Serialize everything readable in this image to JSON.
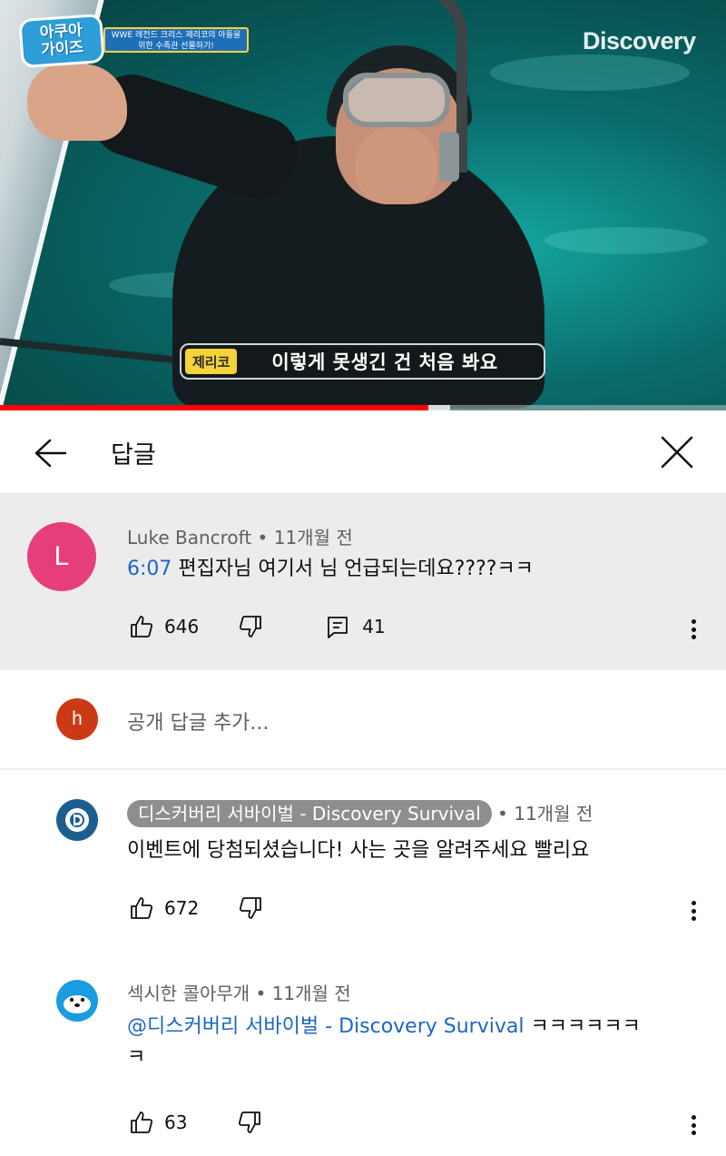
{
  "video": {
    "show_logo_lines": [
      "아쿠아",
      "가이즈"
    ],
    "show_subtitle": "WWE 레전드 크리스 제리코의 아들을 위한 수족관 선물하기!",
    "channel_watermark": "Discovery",
    "caption_speaker": "제리코",
    "caption_text": "이렇게 못생긴 건 처음 봐요",
    "progress_fraction": 0.59,
    "buffer_fraction": 0.62
  },
  "header": {
    "title": "답글",
    "back_icon": "arrow-left-icon",
    "close_icon": "close-icon"
  },
  "parent_comment": {
    "avatar_letter": "L",
    "avatar_color": "#e63e7c",
    "author": "Luke Bancroft",
    "time": "11개월 전",
    "timestamp_link": "6:07",
    "text": " 편집자님 여기서 님 언급되는데요????ㅋㅋ",
    "likes": "646",
    "replies": "41"
  },
  "add_reply": {
    "avatar_letter": "h",
    "avatar_color": "#cc3a15",
    "placeholder": "공개 답글 추가..."
  },
  "replies": [
    {
      "author": "디스커버리 서바이벌 - Discovery Survival",
      "author_is_channel": true,
      "time": "11개월 전",
      "text": "이벤트에 당첨되셨습니다! 사는 곳을 알려주세요 빨리요",
      "likes": "672"
    },
    {
      "author": "섹시한 콜아무개",
      "author_is_channel": false,
      "time": "11개월 전",
      "mention": "@디스커버리 서바이벌 - Discovery Survival",
      "text_line1": " ㅋㅋㅋㅋㅋㅋ",
      "text_line2": "ㅋ",
      "likes": "63"
    }
  ],
  "separator": " • "
}
